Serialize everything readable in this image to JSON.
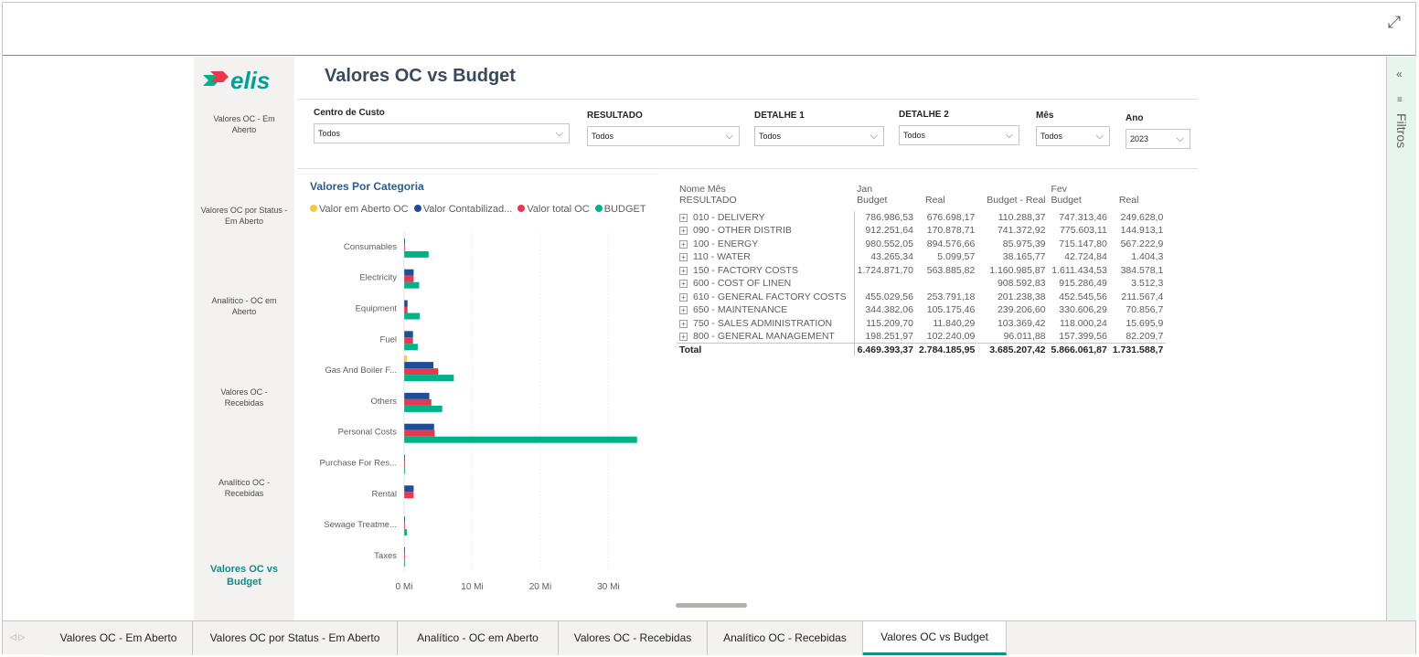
{
  "window": {
    "expand_icon": "expand-icon"
  },
  "nav": {
    "items": [
      {
        "label": "Valores OC - Em Aberto",
        "active": false
      },
      {
        "label": "Valores OC por Status - Em Aberto",
        "active": false
      },
      {
        "label": "Analítico - OC em Aberto",
        "active": false
      },
      {
        "label": "Valores OC - Recebidas",
        "active": false
      },
      {
        "label": "Analítico OC - Recebidas",
        "active": false
      },
      {
        "label": "Valores OC vs Budget",
        "active": true
      }
    ]
  },
  "page": {
    "title": "Valores OC vs Budget",
    "logo_text": "elis"
  },
  "slicers": [
    {
      "label": "Centro de Custo",
      "value": "Todos"
    },
    {
      "label": "RESULTADO",
      "value": "Todos"
    },
    {
      "label": "DETALHE 1",
      "value": "Todos"
    },
    {
      "label": "DETALHE 2",
      "value": "Todos"
    },
    {
      "label": "Mês",
      "value": "Todos"
    },
    {
      "label": "Ano",
      "value": "2023"
    }
  ],
  "chart_data": {
    "type": "bar",
    "orientation": "horizontal",
    "title": "Valores Por Categoria",
    "categories": [
      "Consumables",
      "Electricity",
      "Equipment",
      "Fuel",
      "Gas And Boiler F...",
      "Others",
      "Personal Costs",
      "Purchase For Res...",
      "Rental",
      "Sewage Treatme...",
      "Taxes"
    ],
    "series": [
      {
        "name": "Valor em Aberto OC",
        "color": "#f2c94c",
        "values": [
          0,
          0,
          0,
          0,
          0.4,
          0,
          0,
          0,
          0,
          0,
          0
        ]
      },
      {
        "name": "Valor Contabilizad...",
        "color": "#1f4e96",
        "values": [
          0.1,
          1.4,
          0.5,
          1.3,
          4.3,
          3.7,
          4.4,
          0.1,
          1.4,
          0.1,
          0.05
        ]
      },
      {
        "name": "Valor total OC",
        "color": "#e8384f",
        "values": [
          0.1,
          1.4,
          0.5,
          1.3,
          5.0,
          4.0,
          4.5,
          0.1,
          1.4,
          0.1,
          0.05
        ]
      },
      {
        "name": "BUDGET",
        "color": "#00b386",
        "values": [
          3.6,
          2.2,
          2.3,
          2.0,
          7.3,
          5.6,
          34.2,
          0.1,
          0,
          0.4,
          0.1
        ]
      }
    ],
    "xticks": [
      "0 Mi",
      "10 Mi",
      "20 Mi",
      "30 Mi"
    ],
    "xlim": [
      0,
      34.5
    ],
    "grid": true,
    "legend_position": "top"
  },
  "matrix": {
    "header_row1": [
      "Nome Mês",
      "Jan",
      "",
      "",
      "Fev",
      ""
    ],
    "header_row2": [
      "RESULTADO",
      "Budget",
      "Real",
      "Budget - Real",
      "Budget",
      "Real"
    ],
    "rows": [
      {
        "name": "010 - DELIVERY",
        "vals": [
          "786.986,53",
          "676.698,17",
          "110.288,37",
          "747.313,46",
          "249.628,0"
        ]
      },
      {
        "name": "090 - OTHER DISTRIB",
        "vals": [
          "912.251,64",
          "170.878,71",
          "741.372,92",
          "775.603,11",
          "144.913,1"
        ]
      },
      {
        "name": "100 - ENERGY",
        "vals": [
          "980.552,05",
          "894.576,66",
          "85.975,39",
          "715.147,80",
          "567.222,9"
        ]
      },
      {
        "name": "110 - WATER",
        "vals": [
          "43.265,34",
          "5.099,57",
          "38.165,77",
          "42.724,84",
          "1.404,3"
        ]
      },
      {
        "name": "150 - FACTORY COSTS",
        "vals": [
          "1.724.871,70",
          "563.885,82",
          "1.160.985,87",
          "1.611.434,53",
          "384.578,1"
        ]
      },
      {
        "name": "600 - COST OF LINEN",
        "vals": [
          "",
          "",
          "908.592,83",
          "915.286,49",
          "3.512,3"
        ]
      },
      {
        "name": "610 - GENERAL FACTORY COSTS",
        "vals": [
          "455.029,56",
          "253.791,18",
          "201.238,38",
          "452.545,56",
          "211.567,4"
        ]
      },
      {
        "name": "650 - MAINTENANCE",
        "vals": [
          "344.382,06",
          "105.175,46",
          "239.206,60",
          "330.606,29",
          "70.856,7"
        ]
      },
      {
        "name": "750 - SALES ADMINISTRATION",
        "vals": [
          "115.209,70",
          "11.840,29",
          "103.369,42",
          "118.000,24",
          "15.695,9"
        ]
      },
      {
        "name": "800 - GENERAL MANAGEMENT",
        "vals": [
          "198.251,97",
          "102.240,09",
          "96.011,88",
          "157.399,56",
          "82.209,7"
        ]
      }
    ],
    "total": {
      "name": "Total",
      "vals": [
        "6.469.393,37",
        "2.784.185,95",
        "3.685.207,42",
        "5.866.061,87",
        "1.731.588,7"
      ]
    }
  },
  "filters_pane": {
    "label": "Filtros",
    "collapse_icon": "chevron-left-icon",
    "filter_icon": "filter-icon"
  },
  "tabs": [
    {
      "label": "Valores OC - Em Aberto",
      "active": false
    },
    {
      "label": "Valores OC por Status - Em Aberto",
      "active": false
    },
    {
      "label": "Analítico - OC em Aberto",
      "active": false
    },
    {
      "label": "Valores OC - Recebidas",
      "active": false
    },
    {
      "label": "Analítico OC - Recebidas",
      "active": false
    },
    {
      "label": "Valores OC vs Budget",
      "active": true
    }
  ]
}
